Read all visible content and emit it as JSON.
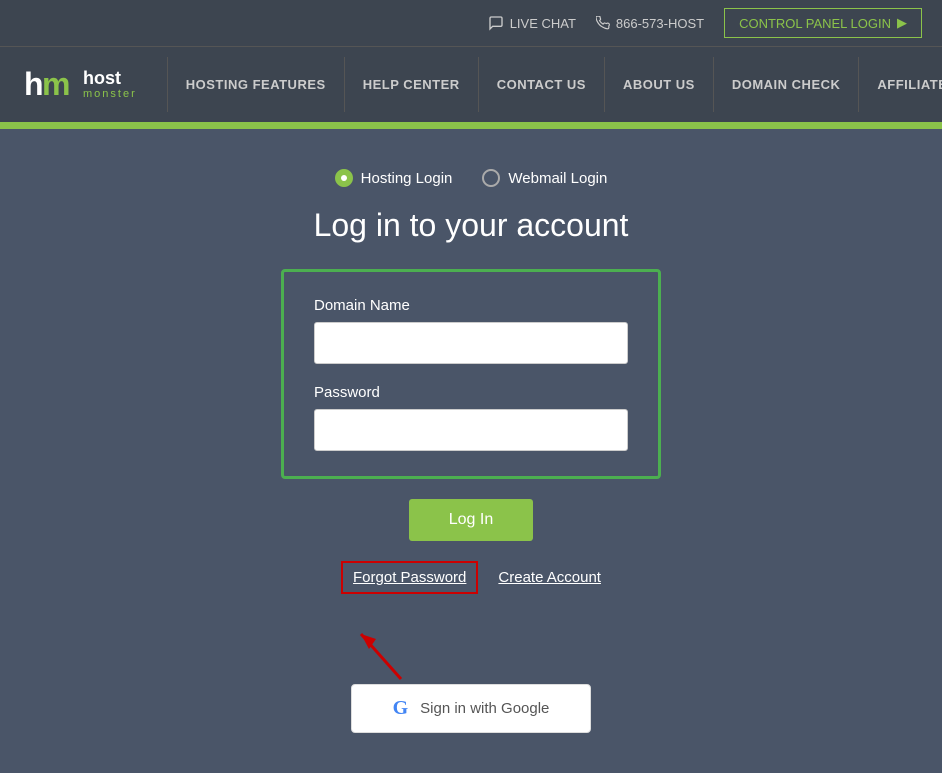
{
  "topbar": {
    "live_chat": "LIVE CHAT",
    "phone": "866-573-HOST",
    "control_panel_btn": "CONTROL PANEL LOGIN"
  },
  "logo": {
    "letters": "hm",
    "host": "host",
    "monster": "monster"
  },
  "nav": {
    "items": [
      {
        "label": "HOSTING FEATURES"
      },
      {
        "label": "HELP CENTER"
      },
      {
        "label": "CONTACT US"
      },
      {
        "label": "ABOUT US"
      },
      {
        "label": "DOMAIN CHECK"
      },
      {
        "label": "AFFILIATES"
      }
    ]
  },
  "login_selector": {
    "hosting_label": "Hosting Login",
    "webmail_label": "Webmail Login"
  },
  "page_title": "Log in to your account",
  "form": {
    "domain_name_label": "Domain Name",
    "domain_name_placeholder": "",
    "password_label": "Password",
    "password_placeholder": ""
  },
  "buttons": {
    "login": "Log In",
    "forgot_password": "Forgot Password",
    "create_account": "Create Account",
    "google_signin": "Sign in with Google"
  }
}
